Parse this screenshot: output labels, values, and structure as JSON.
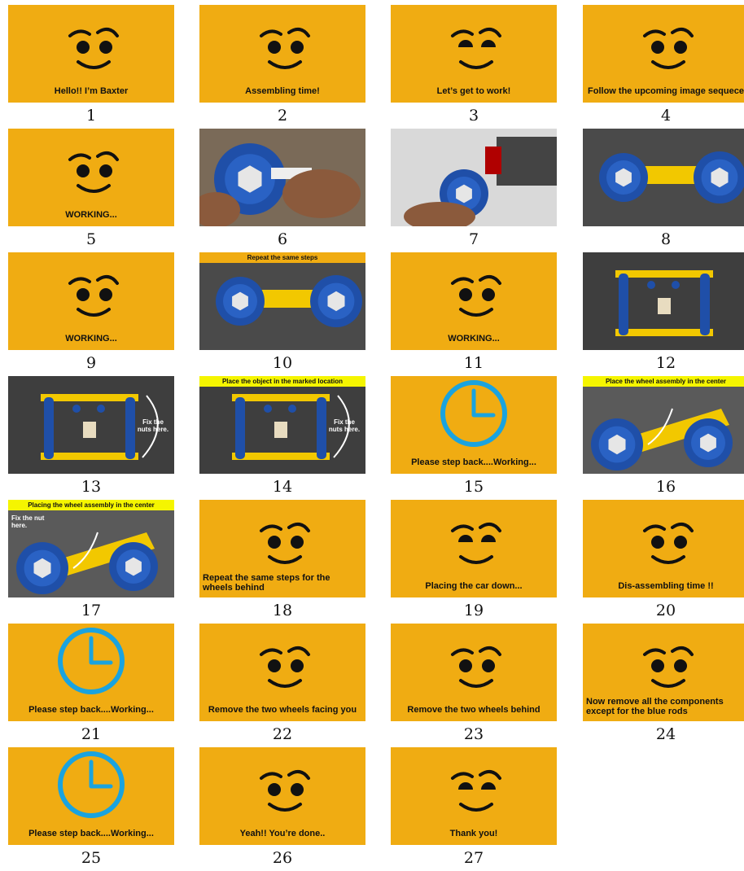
{
  "colors": {
    "panel": "#f0ac12",
    "clock": "#1aa3df",
    "banner_yellow": "#f5f500",
    "photo_bg": "#3a3a3a"
  },
  "frames": [
    {
      "n": "1",
      "kind": "face",
      "face": "happy",
      "caption": "Hello!! I’m Baxter"
    },
    {
      "n": "2",
      "kind": "face",
      "face": "happy",
      "caption": "Assembling time!"
    },
    {
      "n": "3",
      "kind": "face",
      "face": "focused",
      "caption": "Let’s get to work!"
    },
    {
      "n": "4",
      "kind": "face",
      "face": "happy",
      "caption": "Follow the upcoming image sequece"
    },
    {
      "n": "5",
      "kind": "face",
      "face": "happy",
      "caption": "WORKING..."
    },
    {
      "n": "6",
      "kind": "photo",
      "scene": "hands-wheel-bolt"
    },
    {
      "n": "7",
      "kind": "photo",
      "scene": "robot-gripper-wheel"
    },
    {
      "n": "8",
      "kind": "photo",
      "scene": "wheels-on-axle"
    },
    {
      "n": "9",
      "kind": "face",
      "face": "happy",
      "caption": "WORKING..."
    },
    {
      "n": "10",
      "kind": "photo",
      "scene": "wheels-on-axle",
      "banner": "Repeat the same steps",
      "banner_style": "orange"
    },
    {
      "n": "11",
      "kind": "face",
      "face": "happy",
      "caption": "WORKING..."
    },
    {
      "n": "12",
      "kind": "photo",
      "scene": "frame-top"
    },
    {
      "n": "13",
      "kind": "photo",
      "scene": "frame-top-nuts",
      "note": "Fix the nuts here."
    },
    {
      "n": "14",
      "kind": "photo",
      "scene": "frame-top-nuts",
      "banner": "Place the object in the marked location",
      "banner_style": "yellow",
      "note": "Fix the nuts here."
    },
    {
      "n": "15",
      "kind": "clock",
      "caption": "Please step back....Working..."
    },
    {
      "n": "16",
      "kind": "photo",
      "scene": "wheel-center",
      "banner": "Place the wheel assembly in the center",
      "banner_style": "yellow"
    },
    {
      "n": "17",
      "kind": "photo",
      "scene": "wheel-center",
      "banner": "Placing the wheel assembly in the center",
      "banner_style": "yellow",
      "note": "Fix the nut here."
    },
    {
      "n": "18",
      "kind": "face",
      "face": "happy",
      "caption": "Repeat the same steps for the wheels behind",
      "align": "left"
    },
    {
      "n": "19",
      "kind": "face",
      "face": "relaxed",
      "caption": "Placing the car down..."
    },
    {
      "n": "20",
      "kind": "face",
      "face": "happy",
      "caption": "Dis-assembling time !!"
    },
    {
      "n": "21",
      "kind": "clock",
      "caption": "Please step back....Working..."
    },
    {
      "n": "22",
      "kind": "face",
      "face": "happy",
      "caption": "Remove the two wheels facing you"
    },
    {
      "n": "23",
      "kind": "face",
      "face": "happy",
      "caption": "Remove the two wheels behind"
    },
    {
      "n": "24",
      "kind": "face",
      "face": "happy",
      "caption": "Now remove all the components except for the blue rods",
      "align": "left"
    },
    {
      "n": "25",
      "kind": "clock",
      "caption": "Please step back....Working..."
    },
    {
      "n": "26",
      "kind": "face",
      "face": "happy",
      "caption": "Yeah!! You’re done.."
    },
    {
      "n": "27",
      "kind": "face",
      "face": "relaxed",
      "caption": "Thank you!"
    }
  ]
}
